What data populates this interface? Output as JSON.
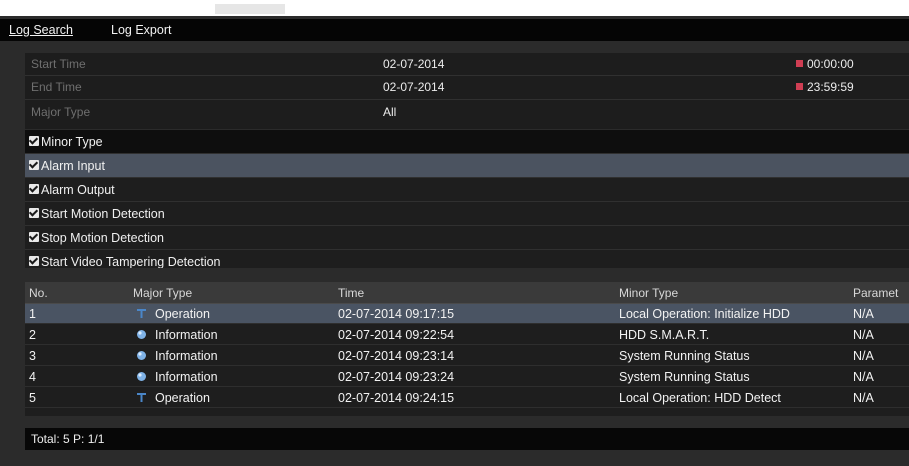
{
  "tabs": [
    {
      "label": "Log Search",
      "active": true
    },
    {
      "label": "Log Export",
      "active": false
    }
  ],
  "search": {
    "start_time": {
      "label": "Start Time",
      "date": "02-07-2014",
      "time": "00:00:00"
    },
    "end_time": {
      "label": "End Time",
      "date": "02-07-2014",
      "time": "23:59:59"
    },
    "major_type": {
      "label": "Major Type",
      "value": "All"
    }
  },
  "minor_types": {
    "header": "Minor Type",
    "items": [
      {
        "label": "Alarm Input",
        "checked": true,
        "selected": true
      },
      {
        "label": "Alarm Output",
        "checked": true,
        "selected": false
      },
      {
        "label": "Start Motion Detection",
        "checked": true,
        "selected": false
      },
      {
        "label": "Stop Motion Detection",
        "checked": true,
        "selected": false
      },
      {
        "label": "Start Video Tampering Detection",
        "checked": true,
        "selected": false
      }
    ]
  },
  "results": {
    "columns": [
      "No.",
      "Major Type",
      "Time",
      "Minor Type",
      "Paramet"
    ],
    "rows": [
      {
        "no": "1",
        "major": "Operation",
        "icon": "operation-icon",
        "time": "02-07-2014 09:17:15",
        "minor": "Local Operation: Initialize HDD",
        "param": "N/A",
        "selected": true
      },
      {
        "no": "2",
        "major": "Information",
        "icon": "information-icon",
        "time": "02-07-2014 09:22:54",
        "minor": "HDD S.M.A.R.T.",
        "param": "N/A",
        "selected": false
      },
      {
        "no": "3",
        "major": "Information",
        "icon": "information-icon",
        "time": "02-07-2014 09:23:14",
        "minor": "System Running Status",
        "param": "N/A",
        "selected": false
      },
      {
        "no": "4",
        "major": "Information",
        "icon": "information-icon",
        "time": "02-07-2014 09:23:24",
        "minor": "System Running Status",
        "param": "N/A",
        "selected": false
      },
      {
        "no": "5",
        "major": "Operation",
        "icon": "operation-icon",
        "time": "02-07-2014 09:24:15",
        "minor": "Local Operation: HDD Detect",
        "param": "N/A",
        "selected": false
      }
    ]
  },
  "footer": {
    "summary": "Total: 5  P: 1/1"
  },
  "colors": {
    "background": "#2b2b2b",
    "selected_row": "#4a5463",
    "calendar_accent": "#cf3e53",
    "operation_icon": "#4a86c8",
    "information_icon": "#7fb2e6"
  }
}
